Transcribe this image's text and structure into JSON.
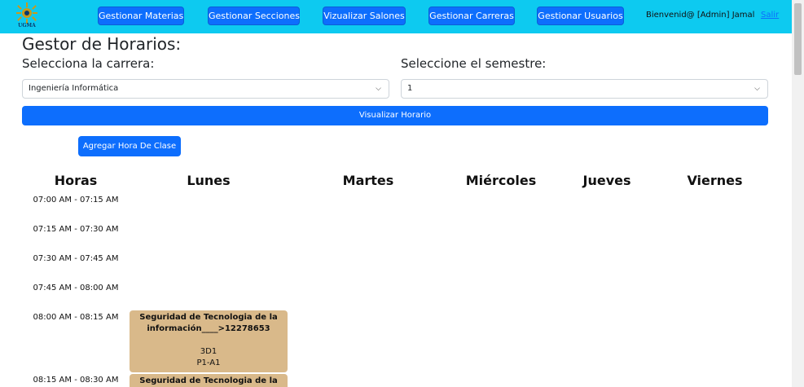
{
  "header": {
    "logo_text": "UGMA",
    "nav": [
      {
        "label": "Gestionar Materias"
      },
      {
        "label": "Gestionar Secciones"
      },
      {
        "label": "Vizualizar Salones"
      },
      {
        "label": "Gestionar Carreras"
      },
      {
        "label": "Gestionar Usuarios"
      }
    ],
    "welcome": "Bienvenid@ [Admin] Jamal",
    "logout": "Salir"
  },
  "page": {
    "title": "Gestor de Horarios:",
    "career_label": "Selecciona la carrera:",
    "career_value": "Ingeniería Informática",
    "semester_label": "Seleccione el semestre:",
    "semester_value": "1",
    "view_button": "Visualizar Horario",
    "add_button": "Agregar Hora De Clase"
  },
  "schedule": {
    "columns": [
      "Horas",
      "Lunes",
      "Martes",
      "Miércoles",
      "Jueves",
      "Viernes"
    ],
    "times": [
      "07:00 AM - 07:15 AM",
      "07:15 AM - 07:30 AM",
      "07:30 AM - 07:45 AM",
      "07:45 AM - 08:00 AM",
      "08:00 AM - 08:15 AM",
      "08:15 AM - 08:30 AM"
    ],
    "classes": [
      {
        "name": "Seguridad de Tecnologia de la información____>12278653",
        "section": "3D1",
        "room": "P1-A1"
      },
      {
        "name": "Seguridad de Tecnologia de la"
      }
    ]
  },
  "colors": {
    "topbar": "#0dcaf0",
    "primary_button": "#0d6efd",
    "class_cell": "#d9b98a"
  }
}
